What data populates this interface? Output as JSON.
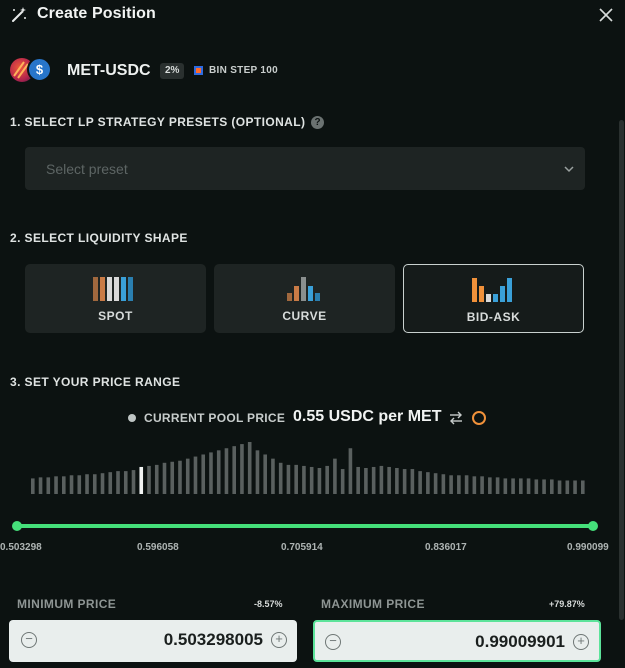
{
  "header": {
    "title": "Create Position"
  },
  "pair": {
    "name": "MET-USDC",
    "fee": "2%",
    "bin_step": "BIN STEP 100",
    "token_b_symbol": "$"
  },
  "sections": {
    "presets": "1. SELECT LP STRATEGY PRESETS (OPTIONAL)",
    "shape": "2. SELECT LIQUIDITY SHAPE",
    "range": "3. SET YOUR PRICE RANGE"
  },
  "help_glyph": "?",
  "preset": {
    "placeholder": "Select preset"
  },
  "shapes": [
    {
      "label": "SPOT",
      "active": false
    },
    {
      "label": "CURVE",
      "active": false
    },
    {
      "label": "BID-ASK",
      "active": true
    }
  ],
  "range": {
    "current_label": "CURRENT POOL PRICE",
    "current_value": "0.55 USDC per MET",
    "ticks": [
      "0.503298",
      "0.596058",
      "0.705914",
      "0.836017",
      "0.990099"
    ]
  },
  "histogram": {
    "bins": [
      15,
      16,
      16,
      17,
      17,
      18,
      18,
      19,
      19,
      20,
      21,
      22,
      22,
      23,
      26,
      27,
      28,
      30,
      31,
      32,
      34,
      36,
      38,
      40,
      42,
      44,
      46,
      48,
      50,
      42,
      38,
      34,
      30,
      28,
      28,
      27,
      26,
      25,
      27,
      34,
      24,
      44,
      26,
      25,
      26,
      27,
      26,
      25,
      24,
      24,
      22,
      21,
      20,
      19,
      18,
      18,
      18,
      17,
      17,
      16,
      16,
      15,
      15,
      15,
      15,
      14,
      14,
      14,
      13,
      13,
      13,
      13
    ],
    "current_index": 14,
    "bar_color": "#5a605f",
    "current_color": "#f2f4f3"
  },
  "min_price": {
    "label": "MINIMUM PRICE",
    "pct": "-8.57%",
    "value": "0.503298005"
  },
  "max_price": {
    "label": "MAXIMUM PRICE",
    "pct": "+79.87%",
    "value": "0.99009901"
  },
  "stepper": {
    "minus": "−",
    "plus": "+"
  },
  "colors": {
    "accent_green": "#45e07a",
    "orange": "#f0913a",
    "blue": "#3aa0d8",
    "brown": "#a0683e"
  },
  "icons": {
    "header": "magic-wand-icon",
    "close": "close-icon",
    "select": "chevron-down-icon",
    "swap": "swap-arrows-icon",
    "refresh": "refresh-ring-icon"
  }
}
